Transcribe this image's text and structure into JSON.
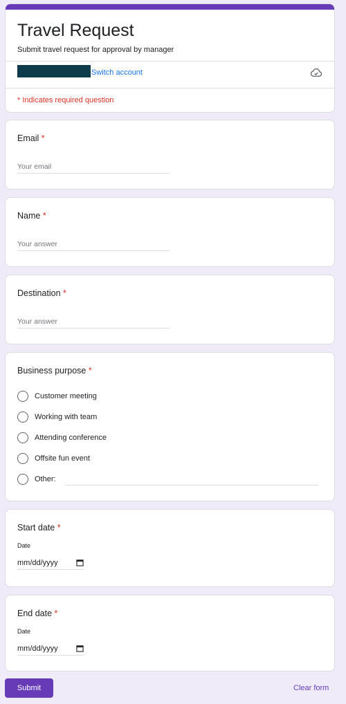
{
  "header": {
    "title": "Travel Request",
    "description": "Submit travel request for approval by manager",
    "switch_account": "Switch account",
    "cloud_icon": "cloud-saved-icon",
    "required_note": "* Indicates required question"
  },
  "questions": {
    "email": {
      "title": "Email",
      "required_mark": "*",
      "placeholder": "Your email"
    },
    "name": {
      "title": "Name",
      "required_mark": "*",
      "placeholder": "Your answer"
    },
    "destination": {
      "title": "Destination",
      "required_mark": "*",
      "placeholder": "Your answer"
    },
    "business_purpose": {
      "title": "Business purpose",
      "required_mark": "*",
      "options": [
        "Customer meeting",
        "Working with team",
        "Attending conference",
        "Offsite fun event",
        "Other:"
      ]
    },
    "start_date": {
      "title": "Start date",
      "required_mark": "*",
      "sublabel": "Date",
      "value": "mm/dd/yyyy"
    },
    "end_date": {
      "title": "End date",
      "required_mark": "*",
      "sublabel": "Date",
      "value": "mm/dd/yyyy"
    }
  },
  "footer": {
    "submit": "Submit",
    "clear": "Clear form"
  },
  "colors": {
    "accent": "#673ab7",
    "background": "#efebf9",
    "required": "#d93025",
    "link": "#1a73e8"
  }
}
